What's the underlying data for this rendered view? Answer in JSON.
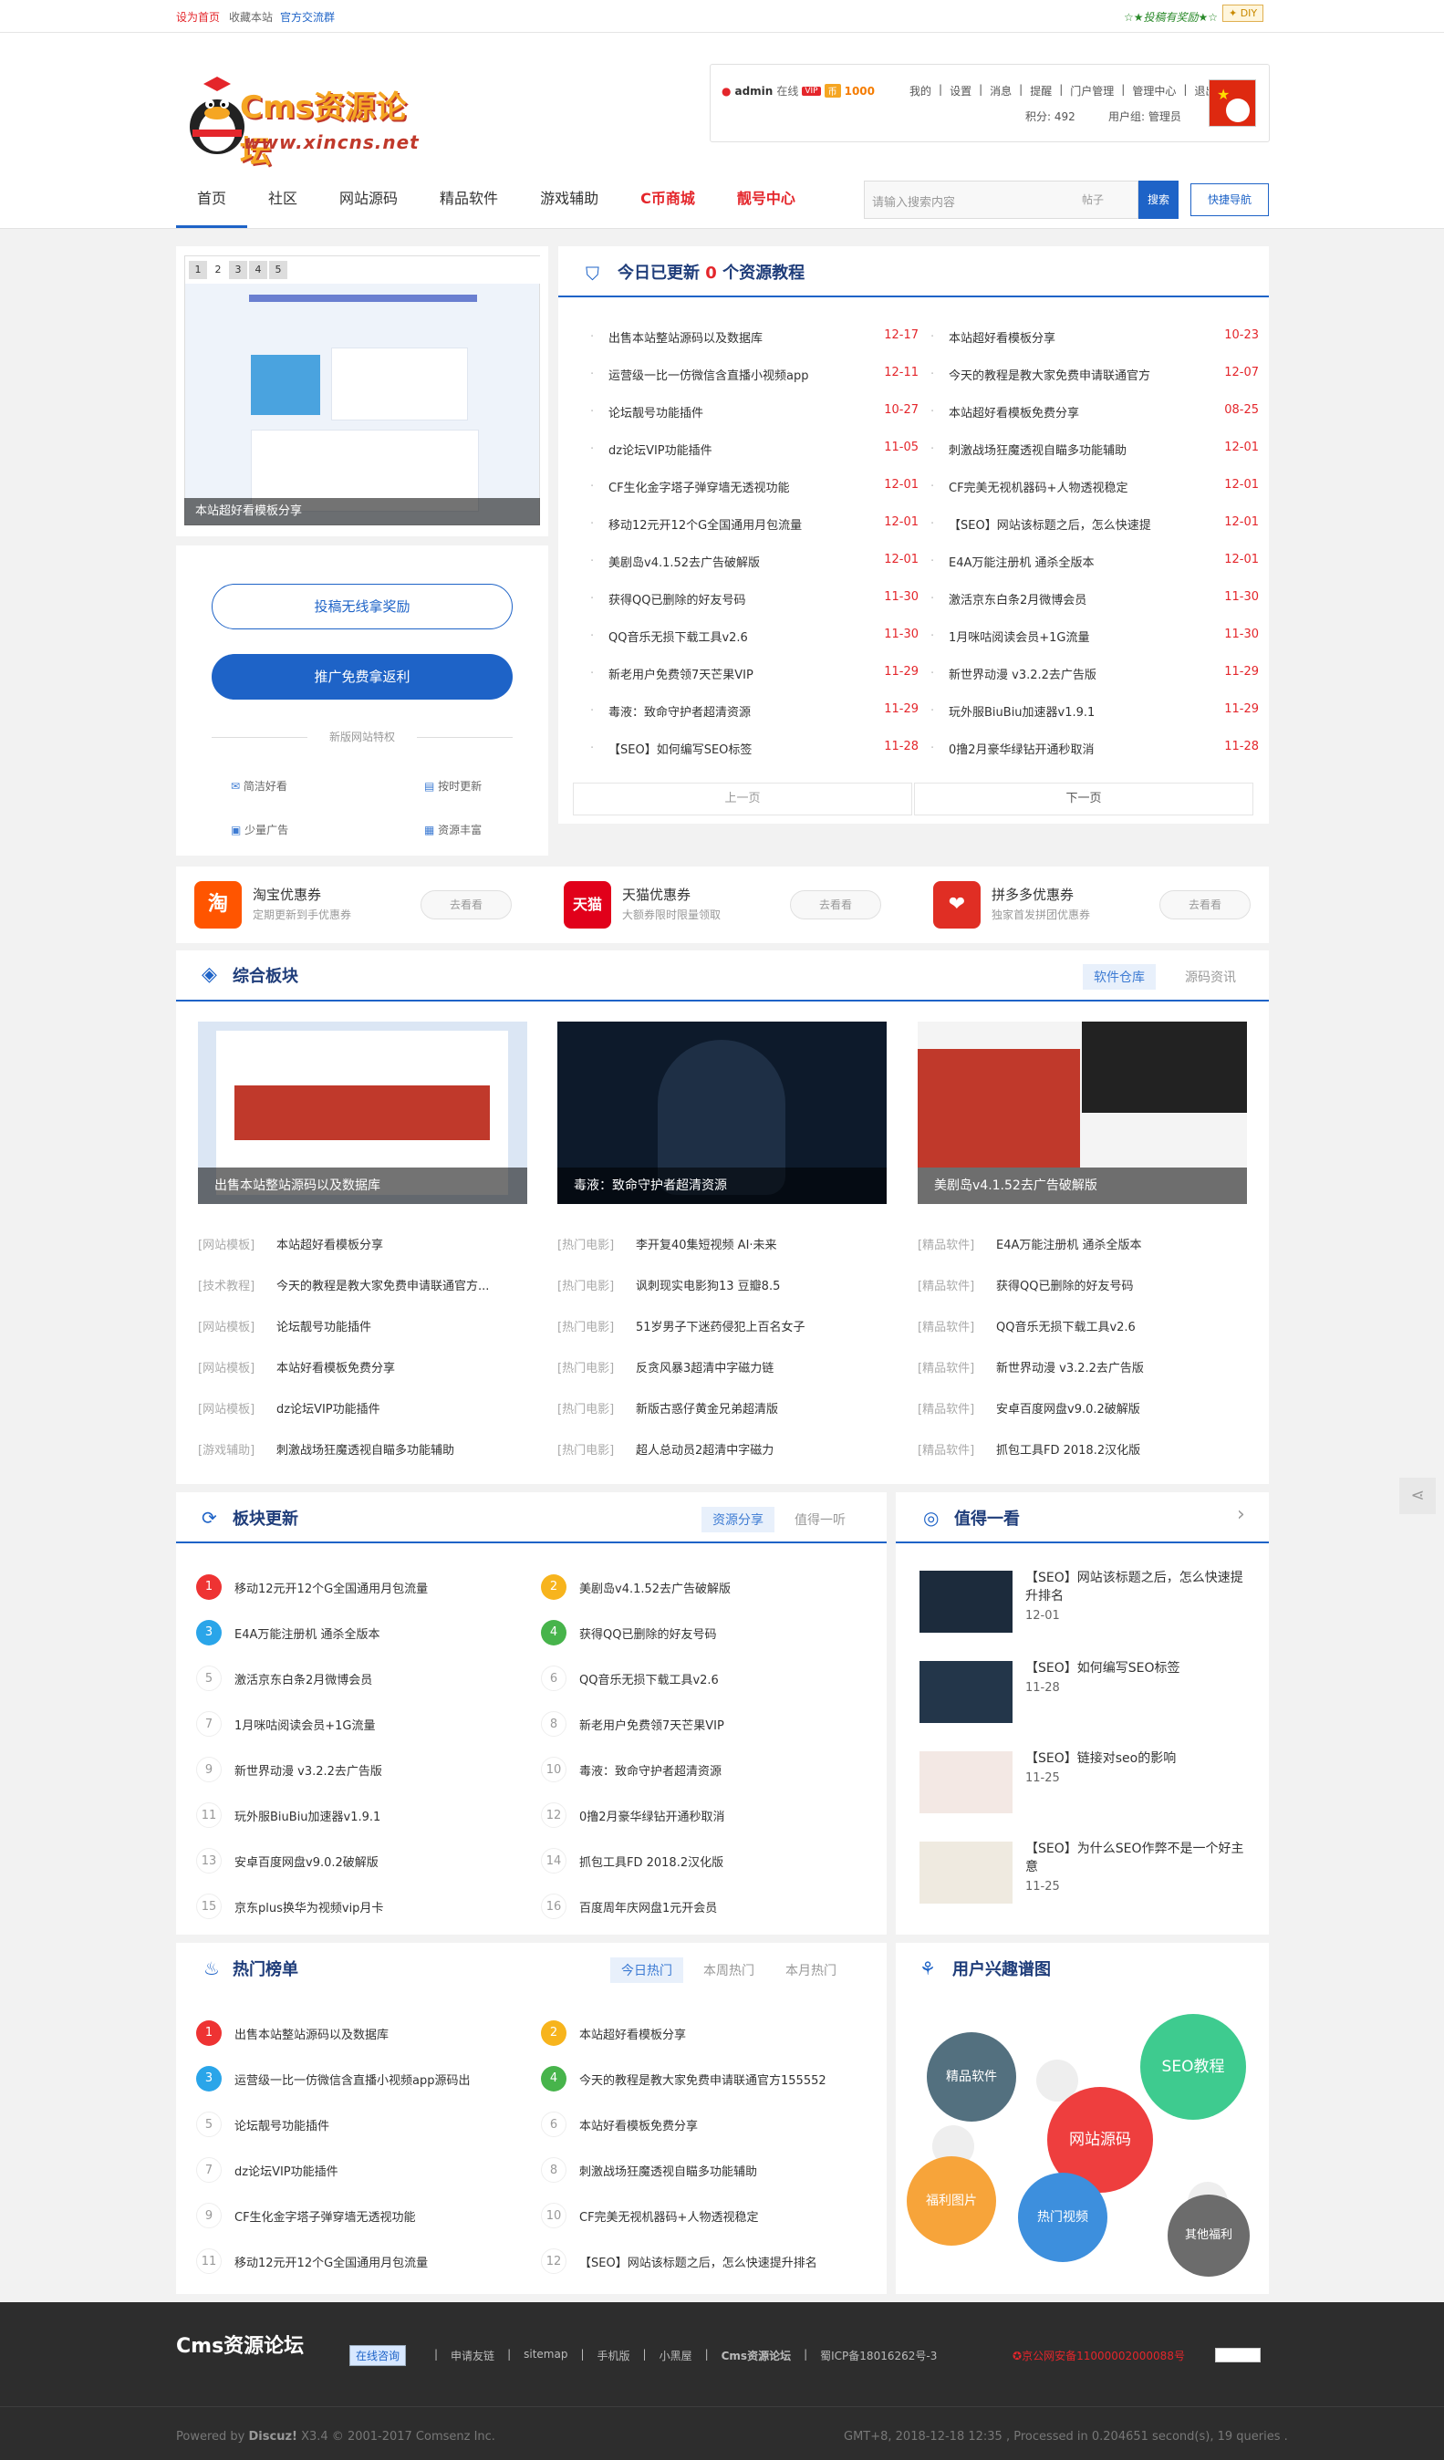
{
  "topbar": {
    "set_home": "设为首页",
    "favorite": "收藏本站",
    "group": "官方交流群",
    "reward": "☆★投稿有奖励★☆",
    "diy": "✦ DIY"
  },
  "logo": {
    "text": "Cms资源论坛",
    "sub": "www.xincns.net"
  },
  "user": {
    "name": "admin",
    "online": "在线",
    "vip": "VIP",
    "coins": "1000",
    "links": [
      "我的",
      "设置",
      "消息",
      "提醒",
      "门户管理",
      "管理中心",
      "退出"
    ],
    "points": "积分: 492",
    "group": "用户组: 管理员"
  },
  "nav": {
    "items": [
      "首页",
      "社区",
      "网站源码",
      "精品软件",
      "游戏辅助",
      "C币商城",
      "靓号中心"
    ]
  },
  "search": {
    "placeholder": "请输入搜索内容",
    "category": "帖子",
    "button": "搜索",
    "quick": "快捷导航"
  },
  "slider": {
    "pages": [
      "1",
      "2",
      "3",
      "4",
      "5"
    ],
    "caption": "本站超好看模板分享"
  },
  "promo": {
    "btn1": "投稿无线拿奖励",
    "btn2": "推广免费拿返利",
    "divider": "新版网站特权",
    "features": [
      "简洁好看",
      "按时更新",
      "少量广告",
      "资源丰富"
    ]
  },
  "today": {
    "title_pre": "今日已更新",
    "count": "0",
    "title_post": "个资源教程",
    "left": [
      [
        "出售本站整站源码以及数据库",
        "12-17"
      ],
      [
        "运营级一比一仿微信含直播小视频app",
        "12-11"
      ],
      [
        "论坛靓号功能插件",
        "10-27"
      ],
      [
        "dz论坛VIP功能插件",
        "11-05"
      ],
      [
        "CF生化金字塔子弹穿墙无透视功能",
        "12-01"
      ],
      [
        "移动12元开12个G全国通用月包流量",
        "12-01"
      ],
      [
        "美剧岛v4.1.52去广告破解版",
        "12-01"
      ],
      [
        "获得QQ已删除的好友号码",
        "11-30"
      ],
      [
        "QQ音乐无损下载工具v2.6",
        "11-30"
      ],
      [
        "新老用户免费领7天芒果VIP",
        "11-29"
      ],
      [
        "毒液：致命守护者超清资源",
        "11-29"
      ],
      [
        "【SEO】如何编写SEO标签",
        "11-28"
      ]
    ],
    "right": [
      [
        "本站超好看模板分享",
        "10-23"
      ],
      [
        "今天的教程是教大家免费申请联通官方",
        "12-07"
      ],
      [
        "本站超好看模板免费分享",
        "08-25"
      ],
      [
        "刺激战场狂魔透视自瞄多功能辅助",
        "12-01"
      ],
      [
        "CF完美无视机器码+人物透视稳定",
        "12-01"
      ],
      [
        "【SEO】网站该标题之后，怎么快速提",
        "12-01"
      ],
      [
        "E4A万能注册机 通杀全版本",
        "12-01"
      ],
      [
        "激活京东白条2月微博会员",
        "11-30"
      ],
      [
        "1月咪咕阅读会员+1G流量",
        "11-30"
      ],
      [
        "新世界动漫 v3.2.2去广告版",
        "11-29"
      ],
      [
        "玩外服BiuBiu加速器v1.9.1",
        "11-29"
      ],
      [
        "0撸2月豪华绿钻开通秒取消",
        "11-28"
      ]
    ],
    "prev": "上一页",
    "next": "下一页"
  },
  "coupons": [
    {
      "name": "淘宝优惠券",
      "desc": "定期更新到手优惠券",
      "btn": "去看看",
      "icon": "淘",
      "color": "#ff5500"
    },
    {
      "name": "天猫优惠券",
      "desc": "大额券限时限量领取",
      "btn": "去看看",
      "icon": "天猫",
      "color": "#e1001a"
    },
    {
      "name": "拼多多优惠券",
      "desc": "独家首发拼团优惠券",
      "btn": "去看看",
      "icon": "❤",
      "color": "#e02e24"
    }
  ],
  "zonghe": {
    "title": "综合板块",
    "tabs": [
      "软件仓库",
      "源码资讯"
    ],
    "images": [
      "出售本站整站源码以及数据库",
      "毒液：致命守护者超清资源",
      "美剧岛v4.1.52去广告破解版"
    ],
    "cols": [
      [
        [
          "[网站模板]",
          "本站超好看模板分享"
        ],
        [
          "[技术教程]",
          "今天的教程是教大家免费申请联通官方..."
        ],
        [
          "[网站模板]",
          "论坛靓号功能插件"
        ],
        [
          "[网站模板]",
          "本站好看模板免费分享"
        ],
        [
          "[网站模板]",
          "dz论坛VIP功能插件"
        ],
        [
          "[游戏辅助]",
          "刺激战场狂魔透视自瞄多功能辅助"
        ]
      ],
      [
        [
          "[热门电影]",
          "李开复40集短视频 AI·未来"
        ],
        [
          "[热门电影]",
          "讽刺现实电影狗13 豆瓣8.5"
        ],
        [
          "[热门电影]",
          "51岁男子下迷药侵犯上百名女子"
        ],
        [
          "[热门电影]",
          "反贪风暴3超清中字磁力链"
        ],
        [
          "[热门电影]",
          "新版古惑仔黄金兄弟超清版"
        ],
        [
          "[热门电影]",
          "超人总动员2超清中字磁力"
        ]
      ],
      [
        [
          "[精品软件]",
          "E4A万能注册机 通杀全版本"
        ],
        [
          "[精品软件]",
          "获得QQ已删除的好友号码"
        ],
        [
          "[精品软件]",
          "QQ音乐无损下载工具v2.6"
        ],
        [
          "[精品软件]",
          "新世界动漫 v3.2.2去广告版"
        ],
        [
          "[精品软件]",
          "安卓百度网盘v9.0.2破解版"
        ],
        [
          "[精品软件]",
          "抓包工具FD 2018.2汉化版"
        ]
      ]
    ]
  },
  "bankuai": {
    "title": "板块更新",
    "tabs": [
      "资源分享",
      "值得一听"
    ],
    "items": [
      "移动12元开12个G全国通用月包流量",
      "美剧岛v4.1.52去广告破解版",
      "E4A万能注册机 通杀全版本",
      "获得QQ已删除的好友号码",
      "激活京东白条2月微博会员",
      "QQ音乐无损下载工具v2.6",
      "1月咪咕阅读会员+1G流量",
      "新老用户免费领7天芒果VIP",
      "新世界动漫 v3.2.2去广告版",
      "毒液：致命守护者超清资源",
      "玩外服BiuBiu加速器v1.9.1",
      "0撸2月豪华绿钻开通秒取消",
      "安卓百度网盘v9.0.2破解版",
      "抓包工具FD 2018.2汉化版",
      "京东plus换华为视频vip月卡",
      "百度周年庆网盘1元开会员"
    ]
  },
  "zhide": {
    "title": "值得一看",
    "items": [
      [
        "【SEO】网站该标题之后，怎么快速提升排名",
        "12-01"
      ],
      [
        "【SEO】如何编写SEO标签",
        "11-28"
      ],
      [
        "【SEO】链接对seo的影响",
        "11-25"
      ],
      [
        "【SEO】为什么SEO作弊不是一个好主意",
        "11-25"
      ]
    ]
  },
  "hot": {
    "title": "热门榜单",
    "tabs": [
      "今日热门",
      "本周热门",
      "本月热门"
    ],
    "items": [
      "出售本站整站源码以及数据库",
      "本站超好看模板分享",
      "运营级一比一仿微信含直播小视频app源码出",
      "今天的教程是教大家免费申请联通官方155552",
      "论坛靓号功能插件",
      "本站好看模板免费分享",
      "dz论坛VIP功能插件",
      "刺激战场狂魔透视自瞄多功能辅助",
      "CF生化金字塔子弹穿墙无透视功能",
      "CF完美无视机器码+人物透视稳定",
      "移动12元开12个G全国通用月包流量",
      "【SEO】网站该标题之后，怎么快速提升排名"
    ]
  },
  "interest": {
    "title": "用户兴趣谱图",
    "bubbles": [
      "精品软件",
      "SEO教程",
      "网站源码",
      "福利图片",
      "热门视频",
      "其他福利"
    ]
  },
  "footer": {
    "logo": "Cms资源论坛",
    "consult": "在线咨询",
    "links": [
      "申请友链",
      "sitemap",
      "手机版",
      "小黑屋",
      "Cms资源论坛",
      "蜀ICP备18016262号-3"
    ],
    "police": "京公网安备11000002000088号",
    "powered_pre": "Powered by",
    "powered_brand": "Discuz!",
    "powered_post": "X3.4 © 2001-2017 Comsenz Inc.",
    "stats": "GMT+8, 2018-12-18 12:35 , Processed in 0.204651 second(s), 19 queries ."
  },
  "colors": {
    "brand": "#1e63c7",
    "accent_red": "#e4262b",
    "footer_bg": "#2d2d2d"
  }
}
